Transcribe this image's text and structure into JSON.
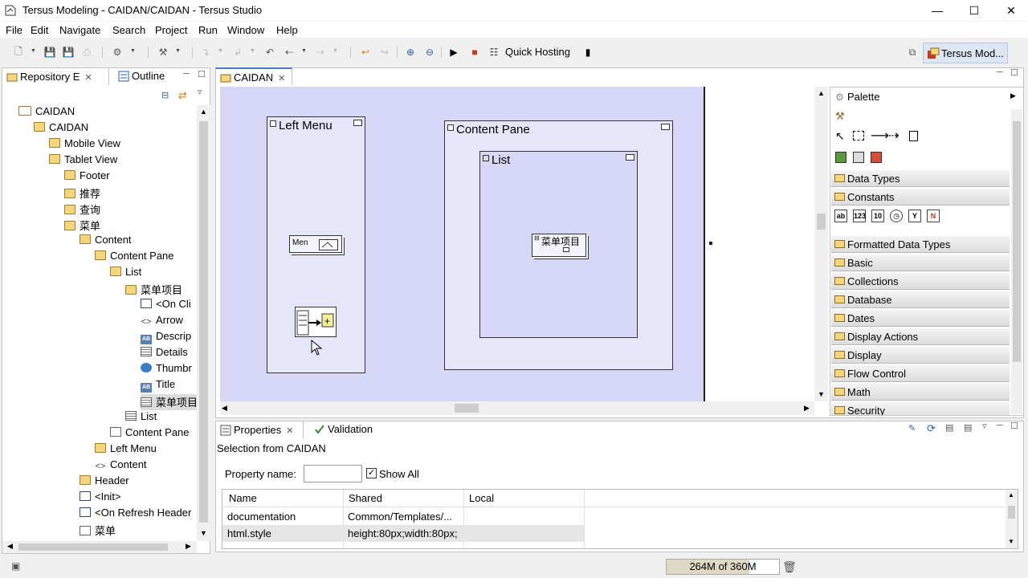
{
  "window": {
    "title": "Tersus Modeling - CAIDAN/CAIDAN - Tersus Studio"
  },
  "menu": [
    "File",
    "Edit",
    "Navigate",
    "Search",
    "Project",
    "Run",
    "Window",
    "Help"
  ],
  "toolbar": {
    "quick_hosting": "Quick Hosting",
    "perspective": "Tersus Mod..."
  },
  "left_panel": {
    "tabs": [
      "Repository E",
      "Outline"
    ],
    "tree": [
      {
        "label": "CAIDAN",
        "depth": 0,
        "icon": "folder"
      },
      {
        "label": "CAIDAN",
        "depth": 1,
        "icon": "package"
      },
      {
        "label": "Mobile View",
        "depth": 2,
        "icon": "package"
      },
      {
        "label": "Tablet View",
        "depth": 2,
        "icon": "package"
      },
      {
        "label": "Footer",
        "depth": 3,
        "icon": "package"
      },
      {
        "label": "推荐",
        "depth": 3,
        "icon": "package"
      },
      {
        "label": "查询",
        "depth": 3,
        "icon": "package"
      },
      {
        "label": "菜单",
        "depth": 3,
        "icon": "package"
      },
      {
        "label": "Content",
        "depth": 4,
        "icon": "package"
      },
      {
        "label": "Content Pane",
        "depth": 5,
        "icon": "package"
      },
      {
        "label": "List",
        "depth": 6,
        "icon": "package"
      },
      {
        "label": "菜单项目",
        "depth": 7,
        "icon": "package"
      },
      {
        "label": "<On Cli",
        "depth": 8,
        "icon": "event"
      },
      {
        "label": "Arrow",
        "depth": 8,
        "icon": "code"
      },
      {
        "label": "Descrip",
        "depth": 8,
        "icon": "text"
      },
      {
        "label": "Details",
        "depth": 8,
        "icon": "details"
      },
      {
        "label": "Thumbr",
        "depth": 8,
        "icon": "globe"
      },
      {
        "label": "Title",
        "depth": 8,
        "icon": "text"
      },
      {
        "label": "菜单项目",
        "depth": 8,
        "icon": "list",
        "selected": true
      },
      {
        "label": "List",
        "depth": 7,
        "icon": "list"
      },
      {
        "label": "Content Pane",
        "depth": 6,
        "icon": "box"
      },
      {
        "label": "Left Menu",
        "depth": 5,
        "icon": "package"
      },
      {
        "label": "Content",
        "depth": 5,
        "icon": "code"
      },
      {
        "label": "Header",
        "depth": 4,
        "icon": "package"
      },
      {
        "label": "<Init>",
        "depth": 4,
        "icon": "event"
      },
      {
        "label": "<On Refresh Header",
        "depth": 4,
        "icon": "event"
      },
      {
        "label": "菜单",
        "depth": 4,
        "icon": "box"
      }
    ]
  },
  "editor": {
    "tab": "CAIDAN",
    "figures": {
      "left_menu": "Left Menu",
      "content_pane": "Content Pane",
      "list": "List",
      "menu_item_small": "Men",
      "menu_item": "菜单项目"
    }
  },
  "palette": {
    "title": "Palette",
    "drawers": [
      "Data Types",
      "Constants",
      "Formatted Data Types",
      "Basic",
      "Collections",
      "Database",
      "Dates",
      "Display Actions",
      "Display",
      "Flow Control",
      "Math",
      "Security"
    ]
  },
  "properties": {
    "tabs": [
      "Properties",
      "Validation"
    ],
    "selection": "Selection from CAIDAN",
    "filter_label": "Property name:",
    "filter_value": "",
    "show_all_label": "Show All",
    "columns": [
      "Name",
      "Shared",
      "Local"
    ],
    "rows": [
      {
        "name": "documentation",
        "shared": "Common/Templates/...",
        "local": ""
      },
      {
        "name": "html.style",
        "shared": "height:80px;width:80px;",
        "local": ""
      }
    ]
  },
  "status": {
    "memory": "264M of 360M",
    "memory_fraction": 0.733
  }
}
